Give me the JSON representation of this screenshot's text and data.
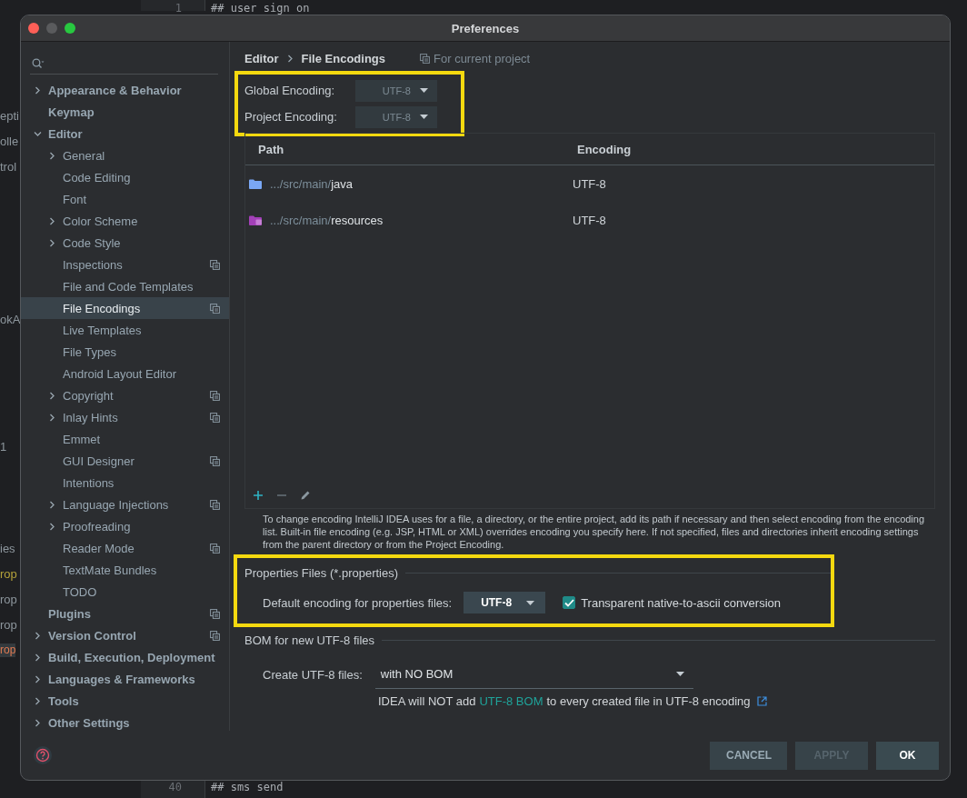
{
  "background_editor": {
    "lines": [
      {
        "number": "1",
        "text": "## user sign on"
      },
      {
        "number": "40",
        "text": "## sms send"
      }
    ],
    "fragments": [
      {
        "text": "epti",
        "kind": "plain"
      },
      {
        "text": "olle",
        "kind": "plain"
      },
      {
        "text": "trol",
        "kind": "plain"
      },
      {
        "text": "okA",
        "kind": "plain"
      },
      {
        "text": "1",
        "kind": "plain"
      },
      {
        "text": "ies",
        "kind": "plain"
      },
      {
        "text": "rop",
        "kind": "warning"
      },
      {
        "text": "rop",
        "kind": "plain"
      },
      {
        "text": "rop",
        "kind": "plain"
      },
      {
        "text": "rop",
        "kind": "selected"
      }
    ]
  },
  "window": {
    "title": "Preferences"
  },
  "sidebar": {
    "items": [
      {
        "label": "Appearance & Behavior",
        "expandable": true,
        "expanded": false,
        "selected": false,
        "project_scope": false
      },
      {
        "label": "Keymap",
        "expandable": false,
        "selected": false,
        "project_scope": false
      },
      {
        "label": "Editor",
        "expandable": true,
        "expanded": true,
        "selected": false,
        "project_scope": false,
        "children": [
          {
            "label": "General",
            "expandable": true,
            "expanded": false,
            "selected": false,
            "project_scope": false
          },
          {
            "label": "Code Editing",
            "expandable": false,
            "selected": false,
            "project_scope": false
          },
          {
            "label": "Font",
            "expandable": false,
            "selected": false,
            "project_scope": false
          },
          {
            "label": "Color Scheme",
            "expandable": true,
            "expanded": false,
            "selected": false,
            "project_scope": false
          },
          {
            "label": "Code Style",
            "expandable": true,
            "expanded": false,
            "selected": false,
            "project_scope": false
          },
          {
            "label": "Inspections",
            "expandable": false,
            "selected": false,
            "project_scope": true
          },
          {
            "label": "File and Code Templates",
            "expandable": false,
            "selected": false,
            "project_scope": false
          },
          {
            "label": "File Encodings",
            "expandable": false,
            "selected": true,
            "project_scope": true
          },
          {
            "label": "Live Templates",
            "expandable": false,
            "selected": false,
            "project_scope": false
          },
          {
            "label": "File Types",
            "expandable": false,
            "selected": false,
            "project_scope": false
          },
          {
            "label": "Android Layout Editor",
            "expandable": false,
            "selected": false,
            "project_scope": false
          },
          {
            "label": "Copyright",
            "expandable": true,
            "expanded": false,
            "selected": false,
            "project_scope": true
          },
          {
            "label": "Inlay Hints",
            "expandable": true,
            "expanded": false,
            "selected": false,
            "project_scope": true
          },
          {
            "label": "Emmet",
            "expandable": false,
            "selected": false,
            "project_scope": false
          },
          {
            "label": "GUI Designer",
            "expandable": false,
            "selected": false,
            "project_scope": true
          },
          {
            "label": "Intentions",
            "expandable": false,
            "selected": false,
            "project_scope": false
          },
          {
            "label": "Language Injections",
            "expandable": true,
            "expanded": false,
            "selected": false,
            "project_scope": true
          },
          {
            "label": "Proofreading",
            "expandable": true,
            "expanded": false,
            "selected": false,
            "project_scope": false
          },
          {
            "label": "Reader Mode",
            "expandable": false,
            "selected": false,
            "project_scope": true
          },
          {
            "label": "TextMate Bundles",
            "expandable": false,
            "selected": false,
            "project_scope": false
          },
          {
            "label": "TODO",
            "expandable": false,
            "selected": false,
            "project_scope": false
          }
        ]
      },
      {
        "label": "Plugins",
        "expandable": false,
        "selected": false,
        "project_scope": true
      },
      {
        "label": "Version Control",
        "expandable": true,
        "expanded": false,
        "selected": false,
        "project_scope": true
      },
      {
        "label": "Build, Execution, Deployment",
        "expandable": true,
        "expanded": false,
        "selected": false,
        "project_scope": false
      },
      {
        "label": "Languages & Frameworks",
        "expandable": true,
        "expanded": false,
        "selected": false,
        "project_scope": false
      },
      {
        "label": "Tools",
        "expandable": true,
        "expanded": false,
        "selected": false,
        "project_scope": false
      },
      {
        "label": "Other Settings",
        "expandable": true,
        "expanded": false,
        "selected": false,
        "project_scope": false
      }
    ]
  },
  "breadcrumb": [
    "Editor",
    "File Encodings"
  ],
  "scope_note": "For current project",
  "encodings": {
    "highlighted": true,
    "fields": [
      {
        "label": "Global Encoding:",
        "value": "UTF-8",
        "disabled": true
      },
      {
        "label": "Project Encoding:",
        "value": "UTF-8",
        "disabled": true
      }
    ]
  },
  "table": {
    "columns": [
      "Path",
      "Encoding"
    ],
    "rows": [
      {
        "kind": "source",
        "prefix": ".../src/main/",
        "name": "java",
        "encoding": "UTF-8"
      },
      {
        "kind": "resources",
        "prefix": ".../src/main/",
        "name": "resources",
        "encoding": "UTF-8"
      }
    ]
  },
  "info": "To change encoding IntelliJ IDEA uses for a file, a directory, or the entire project, add its path if necessary and then select encoding from the encoding list. Built-in file encoding (e.g. JSP, HTML or XML) overrides encoding you specify here. If not specified, files and directories inherit encoding settings from the parent directory or from the Project Encoding.",
  "properties_section": {
    "title": "Properties Files (*.properties)",
    "highlighted": true,
    "label": "Default encoding for properties files:",
    "value": "UTF-8",
    "checkbox": {
      "label": "Transparent native-to-ascii conversion",
      "checked": true
    }
  },
  "bom_section": {
    "title": "BOM for new UTF-8 files",
    "label": "Create UTF-8 files:",
    "value": "with NO BOM",
    "note_before": "IDEA will NOT add",
    "link": "UTF-8 BOM",
    "note_after": "to every created file in UTF-8 encoding"
  },
  "buttons": [
    {
      "label": "CANCEL",
      "kind": "secondary"
    },
    {
      "label": "APPLY",
      "kind": "disabled"
    },
    {
      "label": "OK",
      "kind": "primary"
    }
  ]
}
